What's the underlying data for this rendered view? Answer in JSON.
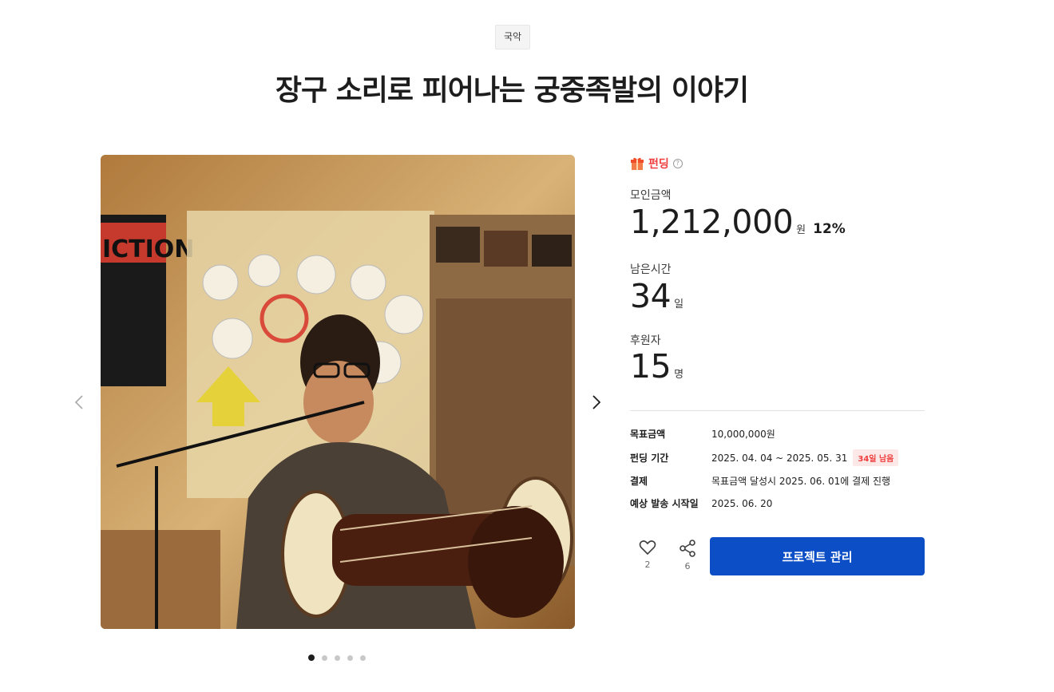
{
  "category": "국악",
  "title": "장구 소리로 피어나는 궁중족발의 이야기",
  "carousel": {
    "slide_count": 5,
    "active_index": 0
  },
  "funding": {
    "label": "펀딩",
    "amount_label": "모인금액",
    "amount_value": "1,212,000",
    "amount_unit": "원",
    "percent": "12%",
    "time_label": "남은시간",
    "time_value": "34",
    "time_unit": "일",
    "backers_label": "후원자",
    "backers_value": "15",
    "backers_unit": "명"
  },
  "details": [
    {
      "key": "목표금액",
      "value": "10,000,000원"
    },
    {
      "key": "펀딩 기간",
      "value": "2025. 04. 04 ~ 2025. 05. 31",
      "badge": "34일 남음"
    },
    {
      "key": "결제",
      "value": "목표금액 달성시 2025. 06. 01에 결제 진행"
    },
    {
      "key": "예상 발송 시작일",
      "value": "2025. 06. 20"
    }
  ],
  "actions": {
    "like_count": "2",
    "share_count": "6",
    "manage_label": "프로젝트 관리"
  },
  "colors": {
    "accent": "#0b4ec6",
    "funding_red": "#f03e3e"
  }
}
